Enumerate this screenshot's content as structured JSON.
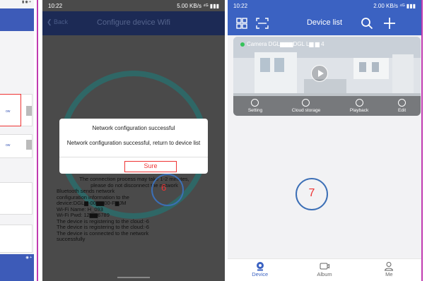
{
  "left_panel": {
    "button_label_1": "ow",
    "button_label_2": "ow"
  },
  "middle_phone": {
    "status_time": "10:22",
    "status_right": "5.00 KB/s  ⁴ᴳ  ▮▮▮",
    "back_label": "Back",
    "title": "Configure device Wifi",
    "dialog": {
      "title": "Network configuration successful",
      "message": "Network configuration successful, return to device list",
      "button": "Sure"
    },
    "log_lines": [
      "The connection process may take 1-2 minutes,",
      "please do not disconnect the network",
      "Bluetooth sends network",
      "configuration information to the",
      "device:DGL▆-00▆▆00-F▆JM",
      "Wi-Fi Name: H_093",
      "Wi-Fi Pwd: 12▆▆6789",
      "The device is registering to the cloud:-6",
      "The device is registering to the cloud:-6",
      "The device is connected to the network",
      "successfully"
    ],
    "step_number": "6"
  },
  "right_phone": {
    "status_time": "10:22",
    "status_right": "2.00 KB/s  ⁴ᴳ  ▮▮▮",
    "title": "Device list",
    "camera": {
      "name": "Camera DGL▆▆▆DGL  L▆ ▆ 4",
      "actions": [
        "Setting",
        "Cloud storage",
        "Playback",
        "Edit"
      ]
    },
    "step_number": "7",
    "tabs": [
      "Device",
      "Album",
      "Me"
    ]
  },
  "colors": {
    "frame": "#c03bb0",
    "accent_blue": "#3b62c2",
    "annotation_red": "#e33333",
    "annotation_circle": "#3c6fb6"
  }
}
